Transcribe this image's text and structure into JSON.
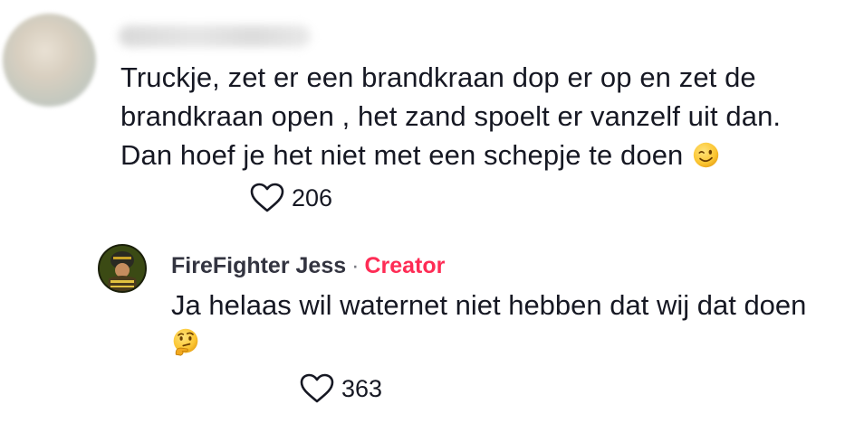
{
  "comment": {
    "text": "Truckje, zet er een brandkraan dop er op en zet de brandkraan open , het zand spoelt er vanzelf uit dan. Dan hoef je het niet met een schepje te doen",
    "emoji": "winking-face-emoji",
    "likes": "206"
  },
  "reply": {
    "author": "FireFighter Jess",
    "separator": "·",
    "badge": "Creator",
    "text": "Ja helaas wil waternet niet hebben dat wij dat doen",
    "emoji": "thinking-face-emoji",
    "likes": "363"
  },
  "colors": {
    "text": "#161823",
    "creator_badge": "#fe2c55",
    "icon": "#161823"
  }
}
